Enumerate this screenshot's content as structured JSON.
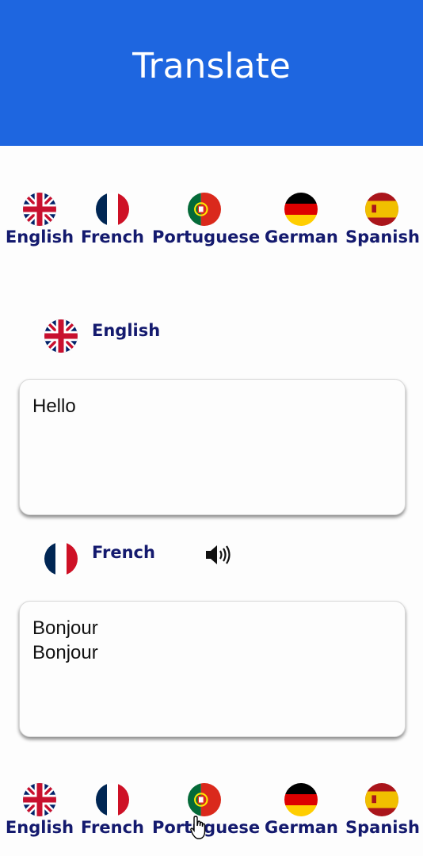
{
  "app": {
    "title": "Translate"
  },
  "colors": {
    "header": "#1e66e0",
    "label": "#141a6e",
    "background": "#fdfdfd"
  },
  "languages": [
    {
      "label": "English",
      "flag": "uk-flag-icon"
    },
    {
      "label": "French",
      "flag": "france-flag-icon"
    },
    {
      "label": "Portuguese",
      "flag": "portugal-flag-icon"
    },
    {
      "label": "German",
      "flag": "germany-flag-icon"
    },
    {
      "label": "Spanish",
      "flag": "spain-flag-icon"
    }
  ],
  "source": {
    "language": "English",
    "text": "Hello"
  },
  "target": {
    "language": "French",
    "text": "Bonjour\nBonjour"
  },
  "icons": {
    "speaker": "speaker-icon",
    "cursor": "hand-cursor-icon"
  }
}
